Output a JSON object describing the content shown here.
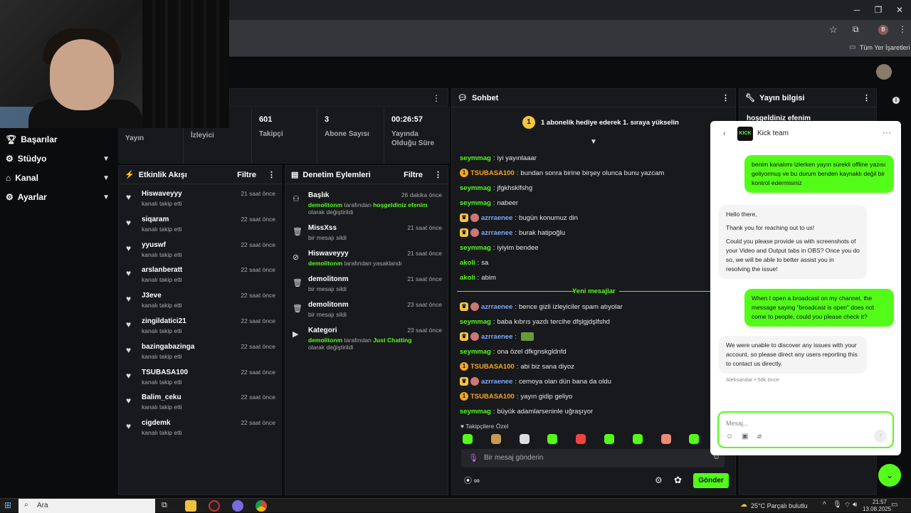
{
  "browser": {
    "bookmarks_label": "Tüm Yer İşaretleri",
    "profile_initial": "B"
  },
  "leftnav": [
    {
      "label": "Başarılar",
      "icon": "trophy-icon",
      "chevron": false
    },
    {
      "label": "Stüdyo",
      "icon": "gear-icon",
      "chevron": true
    },
    {
      "label": "Kanal",
      "icon": "channel-icon",
      "chevron": true
    },
    {
      "label": "Ayarlar",
      "icon": "settings-icon",
      "chevron": true
    }
  ],
  "stats": {
    "yayin_label": "Yayın",
    "izleyici_label": "İzleyici",
    "takipci_value": "601",
    "takipci_label": "Takipçi",
    "abone_value": "3",
    "abone_label": "Abone Sayısı",
    "sure_value": "00:26:57",
    "sure_label": "Yayında Olduğu Süre"
  },
  "activity": {
    "title": "Etkinlik Akışı",
    "filter": "Filtre",
    "items": [
      {
        "name": "Hiswaveyyy",
        "sub": "kanalı takip etti",
        "time": "21 saat önce"
      },
      {
        "name": "siqaram",
        "sub": "kanalı takip etti",
        "time": "22 saat önce"
      },
      {
        "name": "yyuswf",
        "sub": "kanalı takip etti",
        "time": "22 saat önce"
      },
      {
        "name": "arslanberatt",
        "sub": "kanalı takip etti",
        "time": "22 saat önce"
      },
      {
        "name": "J3eve",
        "sub": "kanalı takip etti",
        "time": "22 saat önce"
      },
      {
        "name": "zingildatici21",
        "sub": "kanalı takip etti",
        "time": "22 saat önce"
      },
      {
        "name": "bazingabazinga",
        "sub": "kanalı takip etti",
        "time": "22 saat önce"
      },
      {
        "name": "TSUBASA100",
        "sub": "kanalı takip etti",
        "time": "22 saat önce"
      },
      {
        "name": "Balim_ceku",
        "sub": "kanalı takip etti",
        "time": "22 saat önce"
      },
      {
        "name": "cigdemk",
        "sub": "kanalı takip etti",
        "time": "22 saat önce"
      }
    ]
  },
  "moderation": {
    "title": "Denetim Eylemleri",
    "filter": "Filtre",
    "items": [
      {
        "icon": "users-icon",
        "name": "Başlık",
        "actor": "demolitonm",
        "sub_mid": " tarafından ",
        "highlight": "hoşgeldiniz efenim",
        "sub_end": " olarak değiştirildi",
        "time": "26 dakika önce"
      },
      {
        "icon": "trash-icon",
        "name": "MissXss",
        "actor": "",
        "sub_mid": "bir mesajı sildi",
        "highlight": "",
        "sub_end": "",
        "time": "21 saat önce"
      },
      {
        "icon": "ban-icon",
        "name": "Hiswaveyyy",
        "actor": "demolitonm",
        "sub_mid": " tarafından yasaklandı",
        "highlight": "",
        "sub_end": "",
        "time": "21 saat önce"
      },
      {
        "icon": "trash-icon",
        "name": "demolitonm",
        "actor": "",
        "sub_mid": "bir mesajı sildi",
        "highlight": "",
        "sub_end": "",
        "time": "21 saat önce"
      },
      {
        "icon": "trash-icon",
        "name": "demolitonm",
        "actor": "",
        "sub_mid": "bir mesajı sildi",
        "highlight": "",
        "sub_end": "",
        "time": "23 saat önce"
      },
      {
        "icon": "category-icon",
        "name": "Kategori",
        "actor": "demolitonm",
        "sub_mid": " tarafından ",
        "highlight": "Just Chatting",
        "sub_end": " olarak değiştirildi",
        "time": "23 saat önce"
      }
    ]
  },
  "chat": {
    "title": "Sohbet",
    "pinned": "1 abonelik hediye ederek 1. sıraya yükselin",
    "new_messages": "Yeni mesajlar",
    "followers_only": "Takipçilere Özel",
    "input_placeholder": "Bir mesaj gönderin",
    "send": "Gönder",
    "messages": [
      {
        "user": "seymmag",
        "color": "#53fc18",
        "text": "iyi yayınlaaar",
        "badges": []
      },
      {
        "user": "TSUBASA100",
        "color": "#f5a623",
        "text": "bundan sonra birine birşey olunca bunu yazcam",
        "badges": [
          "gift"
        ]
      },
      {
        "user": "seymmag",
        "color": "#53fc18",
        "text": "jfgkhsklfshg",
        "badges": []
      },
      {
        "user": "seymmag",
        "color": "#53fc18",
        "text": "nabeer",
        "badges": []
      },
      {
        "user": "azrraenee",
        "color": "#7aa9ff",
        "text": "bugün konumuz din",
        "badges": [
          "crown",
          "avatar"
        ]
      },
      {
        "user": "azrraenee",
        "color": "#7aa9ff",
        "text": "burak hatipoğlu",
        "badges": [
          "crown",
          "avatar"
        ]
      },
      {
        "user": "seymmag",
        "color": "#53fc18",
        "text": "iyiyim bendee",
        "badges": []
      },
      {
        "user": "akoli",
        "color": "#53fc18",
        "text": "sa",
        "badges": []
      },
      {
        "user": "akoli",
        "color": "#53fc18",
        "text": "abim",
        "badges": []
      },
      {
        "user": "azrraenee",
        "color": "#7aa9ff",
        "text": "bence gizli izleyiciler spam atıyolar",
        "badges": [
          "crown",
          "avatar"
        ]
      },
      {
        "user": "seymmag",
        "color": "#53fc18",
        "text": "baba kıbrıs yazdı tercihe dfşlgjdşlfshd",
        "badges": []
      },
      {
        "user": "azrraenee",
        "color": "#7aa9ff",
        "text": "",
        "badges": [
          "crown",
          "avatar"
        ]
      },
      {
        "user": "seymmag",
        "color": "#53fc18",
        "text": "ona özel dfkgnskgldnfd",
        "badges": []
      },
      {
        "user": "TSUBASA100",
        "color": "#f5a623",
        "text": "abi biz sana diyoz",
        "badges": [
          "gift"
        ]
      },
      {
        "user": "azrraenee",
        "color": "#7aa9ff",
        "text": "cemoya olan dün bana da oldu",
        "badges": [
          "crown",
          "avatar"
        ]
      },
      {
        "user": "TSUBASA100",
        "color": "#f5a623",
        "text": "yayın gidip geliyo",
        "badges": [
          "gift"
        ]
      },
      {
        "user": "seymmag",
        "color": "#53fc18",
        "text": "büyük adamlarseninle uğraşıyor",
        "badges": []
      }
    ]
  },
  "stream_info": {
    "title": "Yayın bilgisi",
    "stream_title": "hoşgeldiniz efenim"
  },
  "dm": {
    "brand": "KICK",
    "title": "Kick team",
    "msg1": "benim kanalımı izlerken yayın sürekli offline yazısı geliyormuş ve bu durum benden kaynaklı değil bir kontrol edermisiniz",
    "msg2_a": "Hello there,",
    "msg2_b": "Thank you for reaching out to us!",
    "msg2_c": "Could you please provide us with screenshots of your Video and Output tabs in OBS? Once you do so, we will be able to better assist you in resolving the issue!",
    "msg3": "When I open a broadcast on my channel, the message saying \"broadcast is open\" does not come to people, could you please check it?",
    "msg4": "We were unable to discover any issues with your account, so please direct any users reporting this to contact us directly.",
    "meta": "Aleksandar • 5dk önce",
    "placeholder": "Mesaj..."
  },
  "taskbar": {
    "search": "Ara",
    "weather": "25°C  Parçalı bulutlu",
    "time": "21:57",
    "date": "13.08.2025"
  },
  "colors": {
    "accent": "#53fc18",
    "bg": "#0b0c0e",
    "panel": "#18191c"
  }
}
